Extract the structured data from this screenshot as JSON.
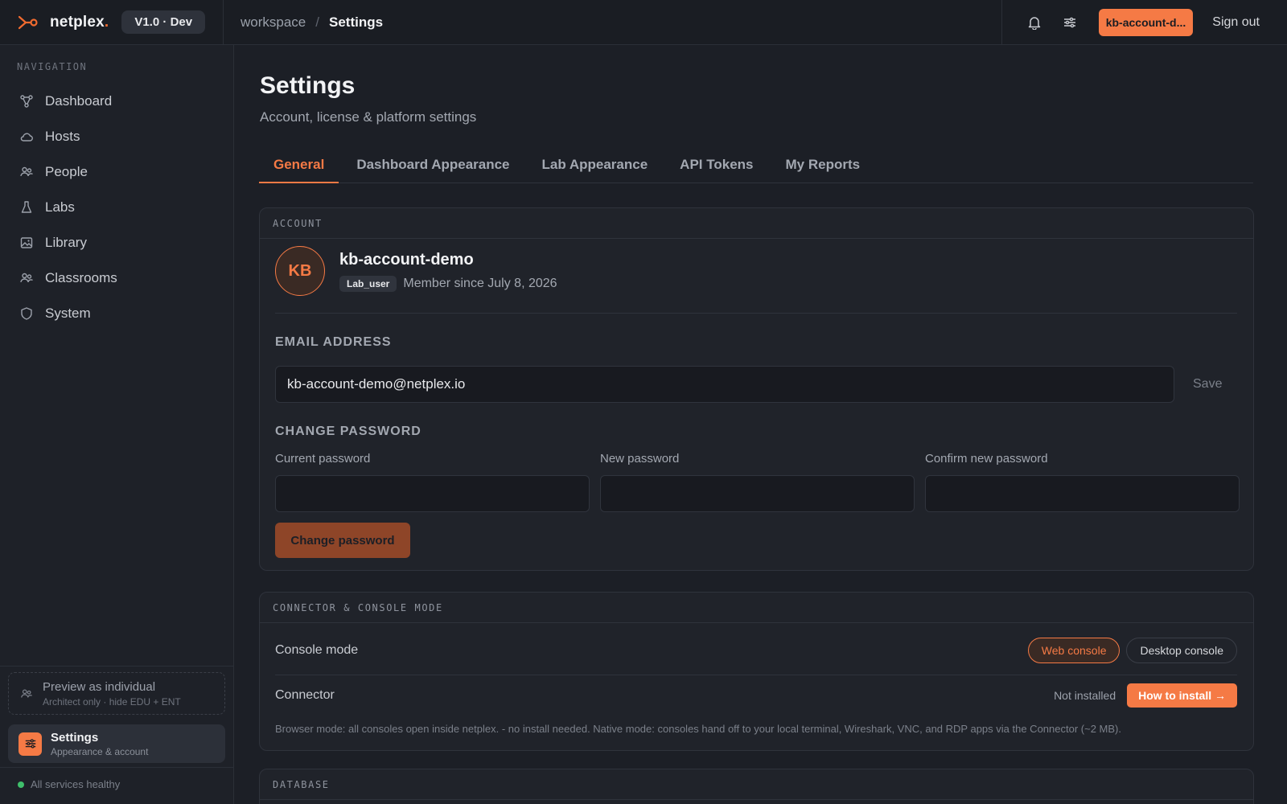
{
  "brand": {
    "name": "netplex",
    "dot": ".",
    "version": "V1.0 · Dev"
  },
  "breadcrumb": {
    "workspace": "workspace",
    "separator": "/",
    "current": "Settings"
  },
  "topbar": {
    "account_button": "kb-account-d...",
    "sign_out": "Sign out"
  },
  "sidebar": {
    "heading": "NAVIGATION",
    "items": [
      {
        "label": "Dashboard",
        "icon": "dashboard-icon"
      },
      {
        "label": "Hosts",
        "icon": "cloud-icon"
      },
      {
        "label": "People",
        "icon": "people-icon"
      },
      {
        "label": "Labs",
        "icon": "flask-icon"
      },
      {
        "label": "Library",
        "icon": "image-icon"
      },
      {
        "label": "Classrooms",
        "icon": "classroom-icon"
      },
      {
        "label": "System",
        "icon": "shield-icon"
      }
    ],
    "preview": {
      "title": "Preview as individual",
      "subtitle": "Architect only · hide EDU + ENT"
    },
    "settings": {
      "title": "Settings",
      "subtitle": "Appearance & account"
    },
    "health": "All services healthy"
  },
  "page": {
    "title": "Settings",
    "subtitle": "Account, license & platform settings",
    "tabs": [
      "General",
      "Dashboard Appearance",
      "Lab Appearance",
      "API Tokens",
      "My Reports"
    ],
    "active_tab": "General"
  },
  "account": {
    "section": "ACCOUNT",
    "initials": "KB",
    "name": "kb-account-demo",
    "role": "Lab_user",
    "member_since": "Member since July 8, 2026",
    "email_label": "EMAIL ADDRESS",
    "email_value": "kb-account-demo@netplex.io",
    "save": "Save",
    "password_label": "CHANGE PASSWORD",
    "current_password": "Current password",
    "new_password": "New password",
    "confirm_password": "Confirm new password",
    "change_button": "Change password"
  },
  "connector": {
    "section": "CONNECTOR & CONSOLE MODE",
    "console_mode_label": "Console mode",
    "web_console": "Web console",
    "desktop_console": "Desktop console",
    "connector_label": "Connector",
    "status": "Not installed",
    "install_button": "How to install →",
    "note": "Browser mode: all consoles open inside netplex. - no install needed. Native mode: consoles hand off to your local terminal, Wireshark, VNC, and RDP apps via the Connector (~2 MB)."
  },
  "database": {
    "section": "DATABASE"
  },
  "colors": {
    "accent": "#f57a45",
    "background": "#1c1f26",
    "healthy": "#3fbf6b"
  }
}
